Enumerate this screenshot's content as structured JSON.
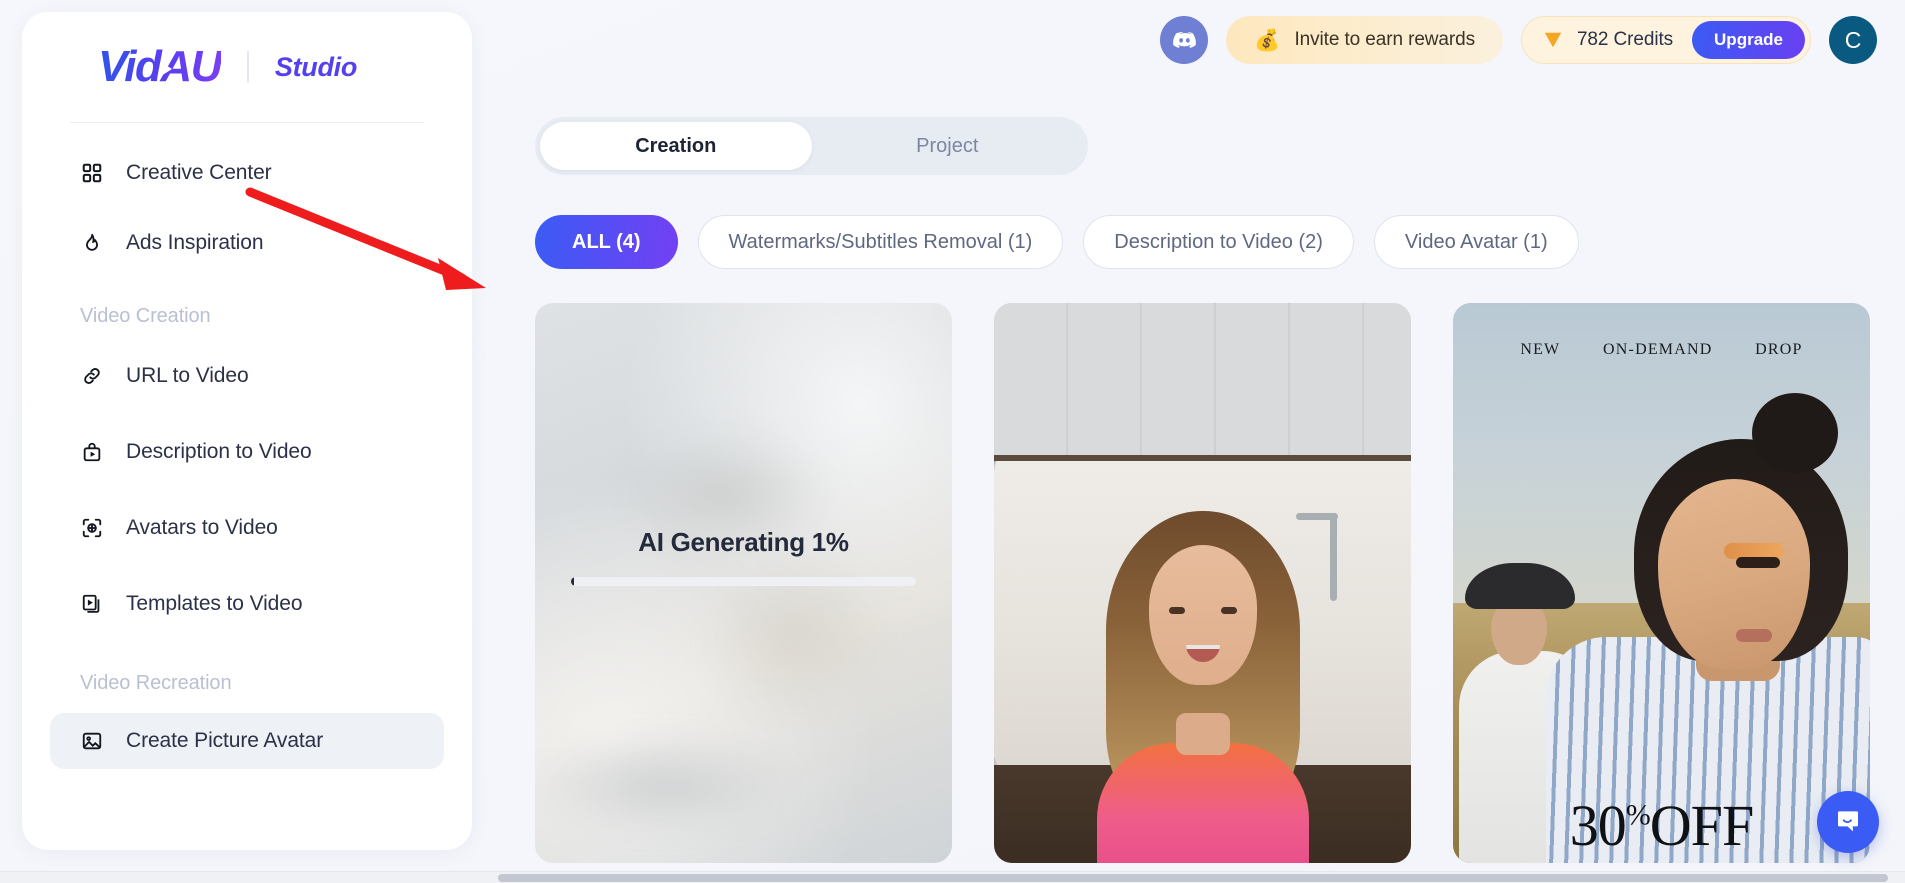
{
  "brand": {
    "logo_text": "VidAU",
    "sub_text": "Studio"
  },
  "sidebar": {
    "top_items": [
      {
        "label": "Creative Center",
        "icon": "grid-icon"
      },
      {
        "label": "Ads Inspiration",
        "icon": "flame-icon"
      }
    ],
    "sections": [
      {
        "title": "Video Creation",
        "items": [
          {
            "label": "URL to Video",
            "icon": "link-icon"
          },
          {
            "label": "Description to Video",
            "icon": "bag-play-icon"
          },
          {
            "label": "Avatars to Video",
            "icon": "avatar-scan-icon"
          },
          {
            "label": "Templates to Video",
            "icon": "template-play-icon"
          }
        ]
      },
      {
        "title": "Video Recreation",
        "items": [
          {
            "label": "Create Picture Avatar",
            "icon": "image-icon",
            "active": true
          }
        ]
      }
    ]
  },
  "header": {
    "discord_icon": "discord-icon",
    "invite": {
      "emoji": "💰",
      "label": "Invite to earn rewards"
    },
    "credits": {
      "gem_icon": "gem-icon",
      "label": "782 Credits",
      "upgrade_label": "Upgrade"
    },
    "avatar_initial": "C"
  },
  "tabs": [
    {
      "label": "Creation",
      "active": true
    },
    {
      "label": "Project",
      "active": false
    }
  ],
  "filters": [
    {
      "label": "ALL (4)",
      "active": true
    },
    {
      "label": "Watermarks/Subtitles Removal (1)",
      "active": false
    },
    {
      "label": "Description to Video (2)",
      "active": false
    },
    {
      "label": "Video Avatar (1)",
      "active": false
    }
  ],
  "cards": [
    {
      "type": "generating",
      "status_label": "AI Generating 1%",
      "progress_percent": 1
    },
    {
      "type": "video-thumbnail",
      "scene": "kitchen-presenter"
    },
    {
      "type": "video-thumbnail",
      "scene": "desert-fashion",
      "overlay_tags": [
        "NEW",
        "ON-DEMAND",
        "DROP"
      ],
      "offer_number": "30",
      "offer_percent": "%",
      "offer_suffix": "OFF"
    }
  ],
  "chat_widget": {
    "icon": "chat-bubble-icon"
  },
  "colors": {
    "accent_blue": "#3b5bf5",
    "accent_purple": "#7340f3",
    "credits_bg": "#fdf3de",
    "invite_bg": "#fde7bd",
    "avatar_bg": "#0a5980",
    "annotation_red": "#ee1c1c"
  }
}
